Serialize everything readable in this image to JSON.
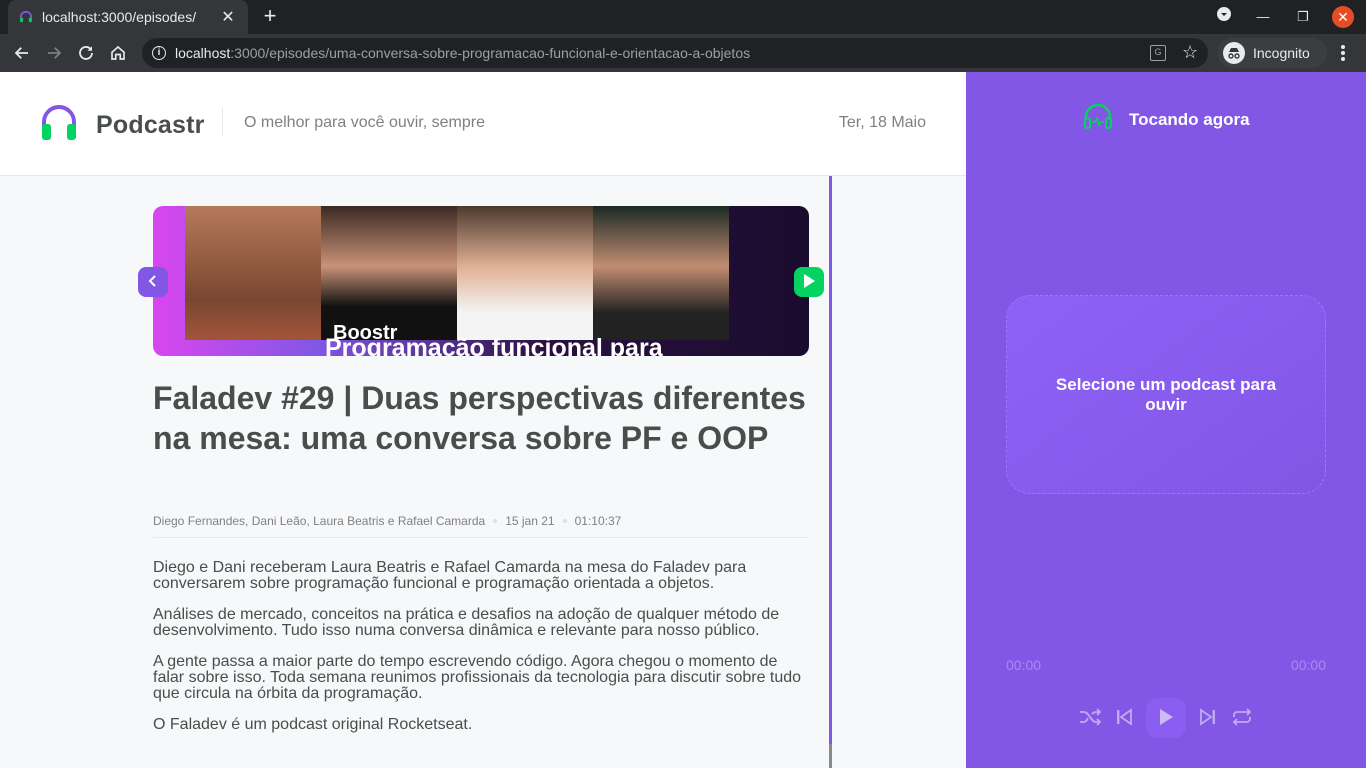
{
  "browser": {
    "tab_title": "localhost:3000/episodes/",
    "url_host": "localhost",
    "url_rest": ":3000/episodes/uma-conversa-sobre-programacao-funcional-e-orientacao-a-objetos",
    "incognito_label": "Incognito"
  },
  "header": {
    "logo_text": "Podcastr",
    "tagline": "O melhor para você ouvir, sempre",
    "date": "Ter, 18 Maio"
  },
  "episode": {
    "thumbnail_caption": "Programação funcional para",
    "thumbnail_badge": "Boostr",
    "title": "Faladev #29 | Duas perspectivas diferentes na mesa: uma conversa sobre PF e OOP",
    "members": "Diego Fernandes, Dani Leão, Laura Beatris e Rafael Camarda",
    "published_at": "15 jan 21",
    "duration": "01:10:37",
    "description": [
      "Diego e Dani receberam Laura Beatris e Rafael Camarda na mesa do Faladev para conversarem sobre programação funcional e programação orientada a objetos.",
      "Análises de mercado, conceitos na prática e desafios na adoção de qualquer método de desenvolvimento. Tudo isso numa conversa dinâmica e relevante para nosso público.",
      "A gente passa a maior parte do tempo escrevendo código. Agora chegou o momento de falar sobre isso. Toda semana reunimos profissionais da tecnologia para discutir sobre tudo que circula na órbita da programação.",
      "O Faladev é um podcast original Rocketseat."
    ]
  },
  "player": {
    "title": "Tocando agora",
    "empty_message": "Selecione um podcast para ouvir",
    "current_time": "00:00",
    "total_time": "00:00"
  },
  "colors": {
    "purple": "#8257e5",
    "green": "#04d361",
    "text": "#494d4b",
    "muted": "#808080"
  },
  "icons": [
    "headphones-icon",
    "back-arrow-icon",
    "play-icon",
    "shuffle-icon",
    "previous-icon",
    "next-icon",
    "repeat-icon"
  ]
}
